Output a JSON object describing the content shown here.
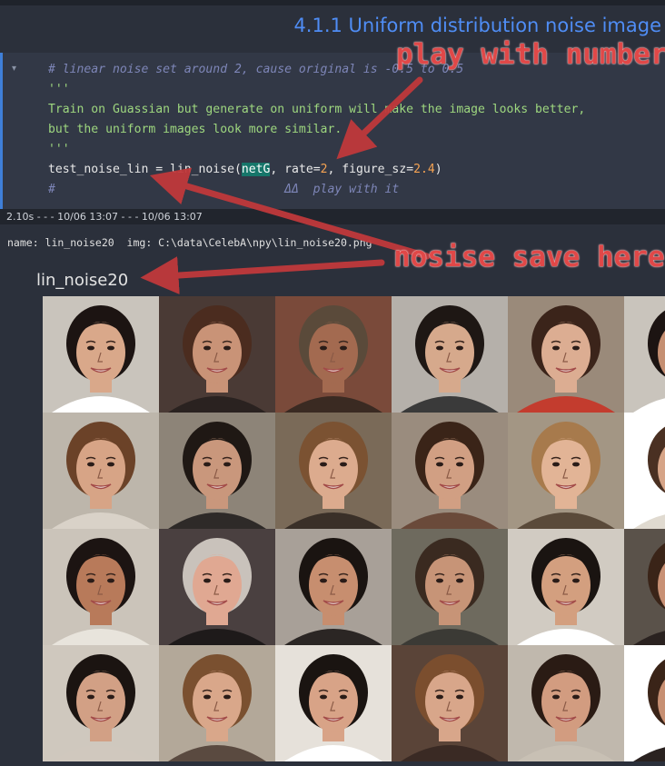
{
  "heading": {
    "text": "4.1.1  Uniform distribution noise image"
  },
  "code_cell": {
    "collapse_glyph": "▾",
    "lines": {
      "l1": "# linear noise set around 2, cause original is -0.5 to 0.5",
      "l2": "'''",
      "l3": "Train on Guassian but generate on uniform will make the image looks better,",
      "l4": "but the uniform images look more similar.",
      "l5": "'''",
      "l6a": "test_noise_lin = lin_noise(",
      "l6b": "netG",
      "l6c": ", rate=",
      "l6d": "2",
      "l6e": ", figure_sz=",
      "l6f": "2.4",
      "l6g": ")",
      "l7": "#                                ΔΔ  play with it"
    }
  },
  "timing": {
    "text": "2.10s - - - 10/06 13:07 - - - 10/06 13:07"
  },
  "output": {
    "meta": "name: lin_noise20  img: C:\\data\\CelebA\\npy\\lin_noise20.png",
    "figure_title": "lin_noise20"
  },
  "annotations": {
    "play": "play with number",
    "save": "nosise save here"
  },
  "faces": [
    {
      "bg": "#c9c4bc",
      "skin": "#d9a88a",
      "hair": "#1c1412",
      "shirt": "#ffffff"
    },
    {
      "bg": "#4a3a35",
      "skin": "#c99377",
      "hair": "#4b2c1f",
      "shirt": "#2a2220"
    },
    {
      "bg": "#7a4a3a",
      "skin": "#a36a50",
      "hair": "#5a4a3a",
      "shirt": "#3a2a22"
    },
    {
      "bg": "#b5b0aa",
      "skin": "#d6a98c",
      "hair": "#1e1714",
      "shirt": "#3a3a3a"
    },
    {
      "bg": "#9a8a7a",
      "skin": "#dcad92",
      "hair": "#3b241a",
      "shirt": "#c33c2e"
    },
    {
      "bg": "#c9c4bc",
      "skin": "#c58f72",
      "hair": "#1c1412",
      "shirt": "#ffffff"
    },
    {
      "bg": "#bdb6ab",
      "skin": "#d7a486",
      "hair": "#6b4228",
      "shirt": "#d9d2c8"
    },
    {
      "bg": "#8d8478",
      "skin": "#c9977c",
      "hair": "#1f1814",
      "shirt": "#2e2a28"
    },
    {
      "bg": "#7a6a58",
      "skin": "#dcab8e",
      "hair": "#7b5232",
      "shirt": "#3a3028"
    },
    {
      "bg": "#9a8c7e",
      "skin": "#d19f83",
      "hair": "#3a2418",
      "shirt": "#6a4a3a"
    },
    {
      "bg": "#a39684",
      "skin": "#e2b496",
      "hair": "#a77a4c",
      "shirt": "#5a4a3a"
    },
    {
      "bg": "#ffffff",
      "skin": "#d6a487",
      "hair": "#4a3022",
      "shirt": "#e0dad0"
    },
    {
      "bg": "#cbc4ba",
      "skin": "#b87a5a",
      "hair": "#1c1412",
      "shirt": "#e8e4dc"
    },
    {
      "bg": "#4a4040",
      "skin": "#e0a892",
      "hair": "#c9c2bb",
      "shirt": "#1e1a1a"
    },
    {
      "bg": "#a8a098",
      "skin": "#c78e6f",
      "hair": "#1a1411",
      "shirt": "#2b2624"
    },
    {
      "bg": "#6e6a5e",
      "skin": "#c79477",
      "hair": "#3a2a20",
      "shirt": "#3b3a35"
    },
    {
      "bg": "#d1cbc2",
      "skin": "#d39f7f",
      "hair": "#1a1411",
      "shirt": "#ffffff"
    },
    {
      "bg": "#5a524a",
      "skin": "#c89074",
      "hair": "#3a2418",
      "shirt": "#2a2220"
    },
    {
      "bg": "#cfc8be",
      "skin": "#d2a085",
      "hair": "#1b1411",
      "shirt": "#d0c8be"
    },
    {
      "bg": "#b3a899",
      "skin": "#d9a78a",
      "hair": "#7a5030",
      "shirt": "#5a4a40"
    },
    {
      "bg": "#e6e1da",
      "skin": "#d8a387",
      "hair": "#1a1411",
      "shirt": "#ffffff"
    },
    {
      "bg": "#5a4438",
      "skin": "#d8a68a",
      "hair": "#7b4e2e",
      "shirt": "#3a2a24"
    },
    {
      "bg": "#c0b8ad",
      "skin": "#d29c80",
      "hair": "#2a1b14",
      "shirt": "#c8c0b4"
    },
    {
      "bg": "#ffffff",
      "skin": "#c78f72",
      "hair": "#3a2418",
      "shirt": "#2a2220"
    }
  ]
}
